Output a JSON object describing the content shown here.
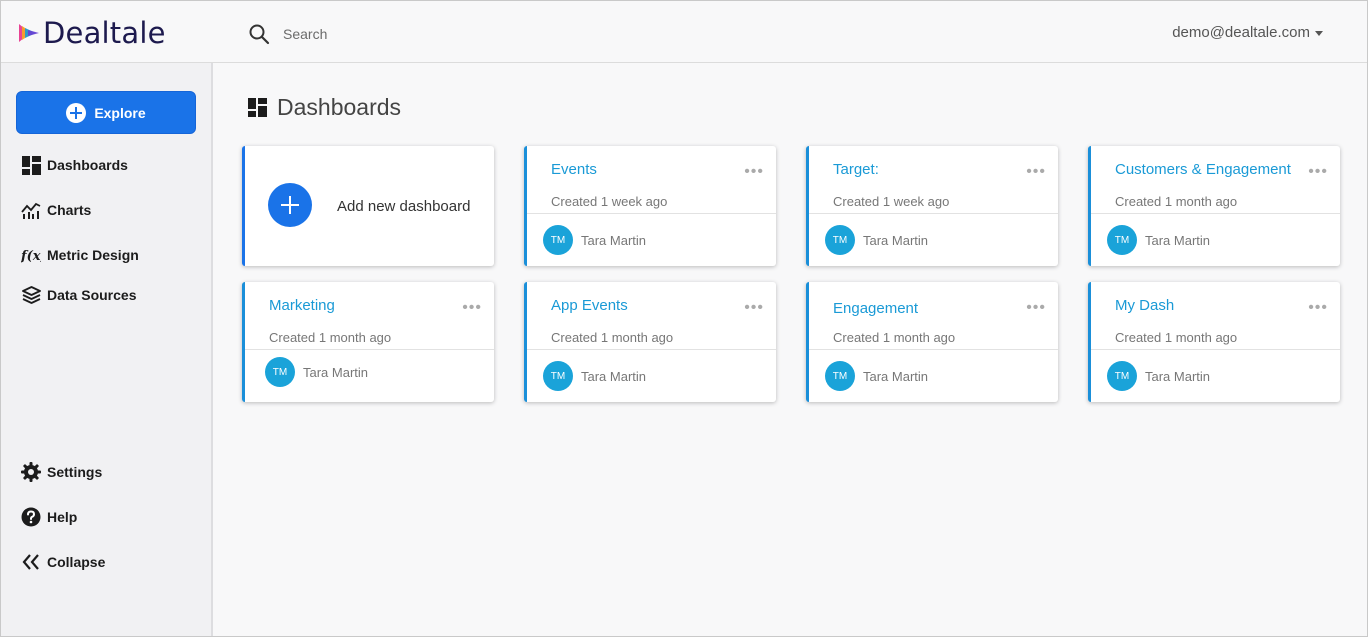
{
  "app": {
    "name": "Dealtale",
    "brand_color": "#1d1a4e",
    "accent": "#1a73e8"
  },
  "header": {
    "search": {
      "placeholder": "Search",
      "value": ""
    },
    "user": "demo@dealtale.com"
  },
  "sidebar": {
    "explore_label": "Explore",
    "items": [
      {
        "label": "Dashboards",
        "icon": "dashboard-icon"
      },
      {
        "label": "Charts",
        "icon": "chart-icon"
      },
      {
        "label": "Metric Design",
        "icon": "function-icon"
      },
      {
        "label": "Data Sources",
        "icon": "layers-icon"
      }
    ],
    "bottom_items": [
      {
        "label": "Settings",
        "icon": "gear-icon"
      },
      {
        "label": "Help",
        "icon": "help-icon"
      },
      {
        "label": "Collapse",
        "icon": "double-chevron-left-icon"
      }
    ]
  },
  "main": {
    "title": "Dashboards",
    "add_label": "Add new dashboard",
    "more_glyph": "•••",
    "cards": [
      {
        "title": "Events",
        "created": "Created 1 week ago",
        "initials": "TM",
        "owner": "Tara Martin"
      },
      {
        "title": "Target:",
        "created": "Created 1 week ago",
        "initials": "TM",
        "owner": "Tara Martin"
      },
      {
        "title": "Customers & Engagement",
        "created": "Created 1 month ago",
        "initials": "TM",
        "owner": "Tara Martin"
      },
      {
        "title": "Marketing",
        "created": "Created 1 month ago",
        "initials": "TM",
        "owner": "Tara Martin"
      },
      {
        "title": "App Events",
        "created": "Created 1 month ago",
        "initials": "TM",
        "owner": "Tara Martin"
      },
      {
        "title": "Engagement",
        "created": "Created 1 month ago",
        "initials": "TM",
        "owner": "Tara Martin"
      },
      {
        "title": "My Dash",
        "created": "Created 1 month ago",
        "initials": "TM",
        "owner": "Tara Martin"
      }
    ]
  }
}
